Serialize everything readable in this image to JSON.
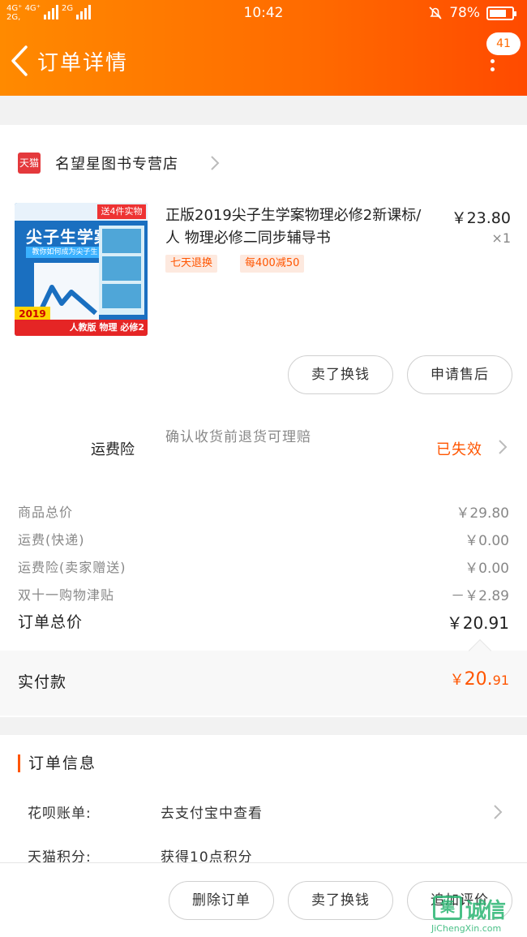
{
  "status_bar": {
    "network_left": "4G⁺ 4G⁺",
    "network_left2": "2G,",
    "network_right": "2G",
    "time": "10:42",
    "battery": "78%",
    "battery_level": 0.78
  },
  "header": {
    "title": "订单详情",
    "message_count": "41"
  },
  "shop": {
    "badge": "天猫",
    "name": "名望星图书专营店"
  },
  "product": {
    "cover_gift": "送4件实物",
    "cover_title": "尖子生学案",
    "cover_sub": "教你如何成为尖子生",
    "cover_year": "2019",
    "cover_bottom": "人教版 物理 必修2",
    "title": "正版2019尖子生学案物理必修2新课标/人 物理必修二同步辅导书",
    "price": "￥23.80",
    "quantity": "×1",
    "tags": [
      "七天退换",
      "每400减50"
    ]
  },
  "actions": {
    "sell_label": "卖了换钱",
    "after_sale_label": "申请售后"
  },
  "insurance": {
    "label": "运费险",
    "desc": "确认收货前退货可理赔",
    "status": "已失效"
  },
  "fees": [
    {
      "label": "商品总价",
      "value": "￥29.80"
    },
    {
      "label": "运费(快递)",
      "value": "￥0.00"
    },
    {
      "label": "运费险(卖家赠送)",
      "value": "￥0.00"
    },
    {
      "label": "双十一购物津贴",
      "value": "－￥2.89"
    }
  ],
  "total": {
    "label": "订单总价",
    "value": "￥20.91"
  },
  "paid": {
    "label": "实付款",
    "currency": "￥",
    "integer": "20.",
    "decimal": "91"
  },
  "order_info": {
    "title": "订单信息",
    "rows": [
      {
        "key": "花呗账单:",
        "value": "去支付宝中查看"
      },
      {
        "key": "天猫积分:",
        "value": "获得10点积分"
      }
    ]
  },
  "bottom_bar": {
    "delete_label": "删除订单",
    "sell_label": "卖了换钱",
    "review_label": "追加评价"
  },
  "watermark": {
    "cn": "诚信",
    "box": "集",
    "en": "JiChengXin.com"
  },
  "colors": {
    "accent": "#ff5500",
    "header_start": "#ff8a00",
    "header_end": "#ff4a00"
  }
}
